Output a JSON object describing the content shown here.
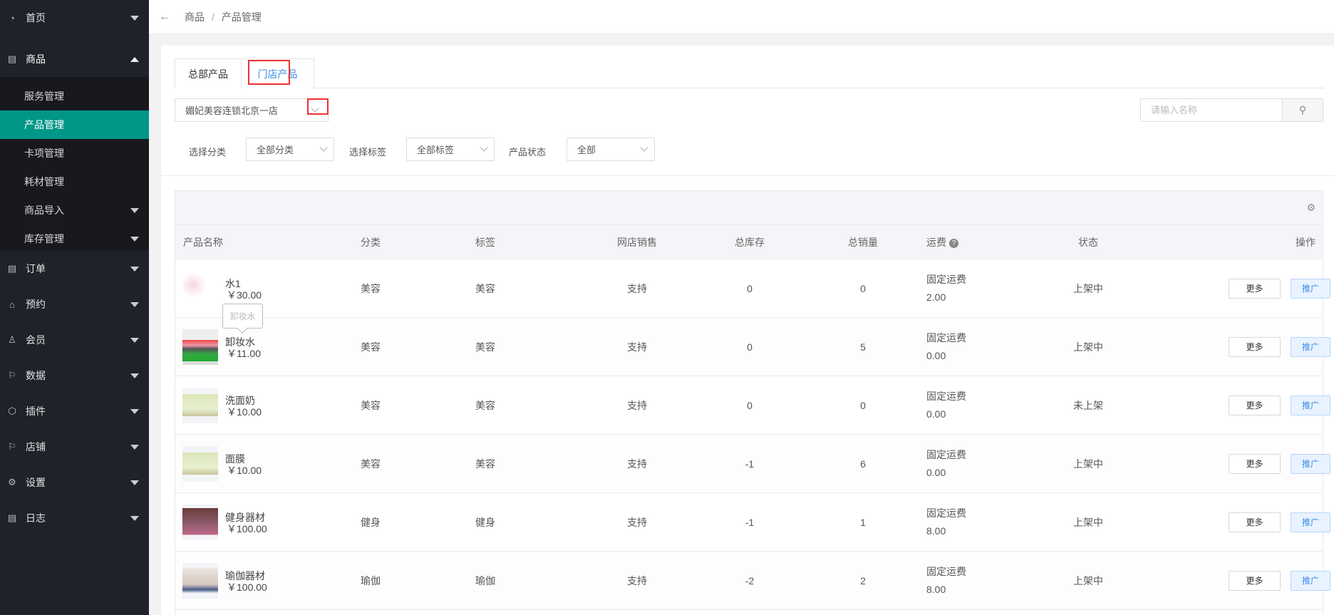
{
  "sidebar": {
    "top": [
      {
        "label": "首页",
        "icon": "dashboard-icon"
      },
      {
        "label": "商品",
        "icon": "document-icon"
      }
    ],
    "sub": [
      {
        "label": "服务管理"
      },
      {
        "label": "产品管理",
        "active": true
      },
      {
        "label": "卡项管理"
      },
      {
        "label": "耗材管理"
      },
      {
        "label": "商品导入",
        "caret": true
      },
      {
        "label": "库存管理",
        "caret": true
      }
    ],
    "rest": [
      {
        "label": "订单",
        "icon": "clipboard-icon"
      },
      {
        "label": "预约",
        "icon": "home-icon"
      },
      {
        "label": "会员",
        "icon": "users-icon"
      },
      {
        "label": "数据",
        "icon": "flag-icon"
      },
      {
        "label": "插件",
        "icon": "cube-icon"
      },
      {
        "label": "店铺",
        "icon": "flag-icon"
      },
      {
        "label": "设置",
        "icon": "gear-icon"
      },
      {
        "label": "日志",
        "icon": "clipboard-icon"
      }
    ]
  },
  "breadcrumb": {
    "parent": "商品",
    "sep": "/",
    "current": "产品管理"
  },
  "tabs": [
    "总部产品",
    "门店产品"
  ],
  "store_select": "媚妃美容连锁北京一店",
  "search": {
    "placeholder": "请输入名称"
  },
  "filters": {
    "category_label": "选择分类",
    "category_value": "全部分类",
    "tag_label": "选择标签",
    "tag_value": "全部标签",
    "status_label": "产品状态",
    "status_value": "全部"
  },
  "columns": [
    "产品名称",
    "分类",
    "标签",
    "网店销售",
    "总库存",
    "总销量",
    "运费",
    "状态",
    "操作"
  ],
  "tooltip": "卸妆水",
  "accent": "#009688",
  "rows": [
    {
      "name": "水1",
      "price": "￥30.00",
      "category": "美容",
      "tag": "美容",
      "online": "支持",
      "stock": "0",
      "sales": "0",
      "fee_type": "固定运费",
      "fee": "2.00",
      "status": "上架中",
      "more": "更多",
      "promo": "推广"
    },
    {
      "name": "卸妆水",
      "price": "￥11.00",
      "category": "美容",
      "tag": "美容",
      "online": "支持",
      "stock": "0",
      "sales": "5",
      "fee_type": "固定运费",
      "fee": "0.00",
      "status": "上架中",
      "more": "更多",
      "promo": "推广"
    },
    {
      "name": "洗面奶",
      "price": "￥10.00",
      "category": "美容",
      "tag": "美容",
      "online": "支持",
      "stock": "0",
      "sales": "0",
      "fee_type": "固定运费",
      "fee": "0.00",
      "status": "未上架",
      "more": "更多",
      "promo": "推广"
    },
    {
      "name": "面膜",
      "price": "￥10.00",
      "category": "美容",
      "tag": "美容",
      "online": "支持",
      "stock": "-1",
      "sales": "6",
      "fee_type": "固定运费",
      "fee": "0.00",
      "status": "上架中",
      "more": "更多",
      "promo": "推广"
    },
    {
      "name": "健身器材",
      "price": "￥100.00",
      "category": "健身",
      "tag": "健身",
      "online": "支持",
      "stock": "-1",
      "sales": "1",
      "fee_type": "固定运费",
      "fee": "8.00",
      "status": "上架中",
      "more": "更多",
      "promo": "推广"
    },
    {
      "name": "瑜伽器材",
      "price": "￥100.00",
      "category": "瑜伽",
      "tag": "瑜伽",
      "online": "支持",
      "stock": "-2",
      "sales": "2",
      "fee_type": "固定运费",
      "fee": "8.00",
      "status": "上架中",
      "more": "更多",
      "promo": "推广"
    }
  ]
}
